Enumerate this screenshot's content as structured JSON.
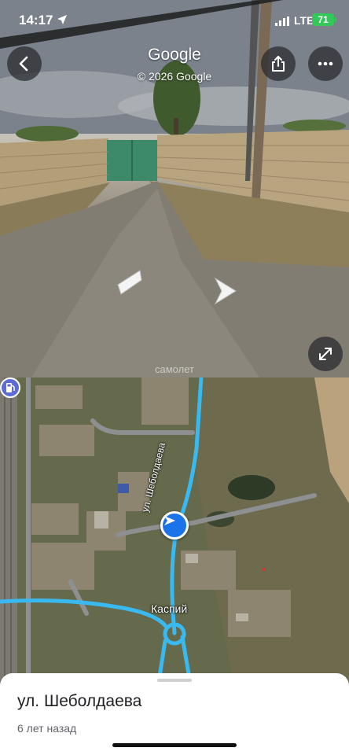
{
  "status_bar": {
    "time": "14:17",
    "network": "LTE",
    "battery": "71"
  },
  "street_view": {
    "title": "Google",
    "copyright": "© 2026 Google",
    "watermark": "самолет",
    "buttons": {
      "back": "chevron-left-icon",
      "share": "share-icon",
      "more": "more-horizontal-icon",
      "expand": "expand-icon"
    }
  },
  "map": {
    "street_label": "ул. Шеболдаева",
    "poi_label": "Каспий",
    "poi_icon": "gas-station-icon",
    "route_color": "#3ab8f0",
    "pegman_color": "#1a73e8"
  },
  "sheet": {
    "title": "ул. Шеболдаева",
    "date": "6 лет назад"
  }
}
